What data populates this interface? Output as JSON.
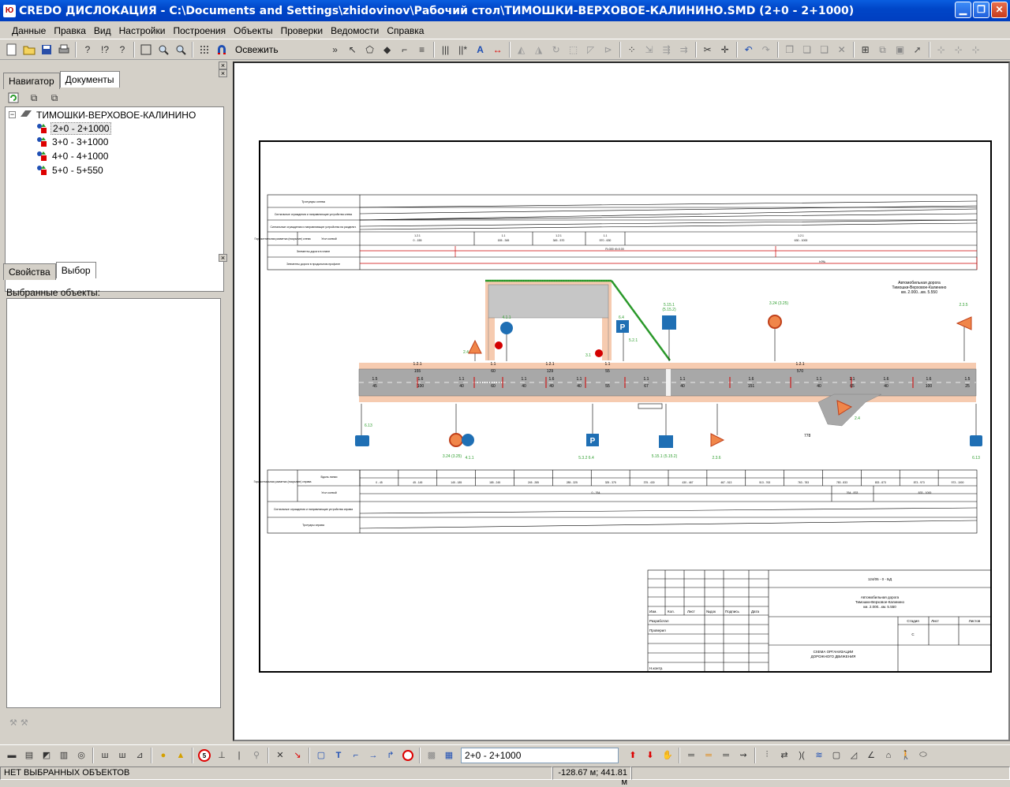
{
  "window": {
    "title": "CREDO ДИСЛОКАЦИЯ - C:\\Documents and Settings\\zhidovinov\\Рабочий стол\\ТИМОШКИ-ВЕРХОВОЕ-КАЛИНИНО.SMD (2+0 - 2+1000)",
    "app_icon_text": "Ю",
    "minimize": "▁",
    "maximize": "❐",
    "close": "✕"
  },
  "menu": [
    "Данные",
    "Правка",
    "Вид",
    "Настройки",
    "Построения",
    "Объекты",
    "Проверки",
    "Ведомости",
    "Справка"
  ],
  "toolbar": {
    "refresh_label": "Освежить",
    "more": "»"
  },
  "left_panel": {
    "tabs": [
      "Навигатор",
      "Документы"
    ],
    "active_tab": "Документы",
    "close": "×",
    "tree": {
      "root": "ТИМОШКИ-ВЕРХОВОЕ-КАЛИНИНО",
      "expander": "−",
      "items": [
        "2+0 - 2+1000",
        "3+0 - 3+1000",
        "4+0 - 4+1000",
        "5+0 - 5+550"
      ],
      "selected": "2+0 - 2+1000"
    },
    "bottom_tabs": [
      "Свойства",
      "Выбор"
    ],
    "bottom_active": "Выбор",
    "selected_objects_label": "Выбранные объекты:"
  },
  "drawing": {
    "header_rows_top": [
      "Тротуары слева",
      "Сигнальные ограждения и направляющие устройства слева",
      "Сигнальные ограждения и направляющие устройства на разделит.",
      "Горизонтальная разметка (покрытие) слева",
      "Элементы дороги в плане",
      "Элементы дороги в продольном профиле"
    ],
    "row4_sub": "Угол осевой",
    "row4_segments": [
      "1.2.1",
      "1.1",
      "1.2.1",
      "1.1",
      "1.2.1"
    ],
    "row4_ranges": [
      "0 - 155",
      "155 - 345",
      "345 - 570",
      "570 - 630",
      "630 - 1000"
    ],
    "plan_label": "R=300 r0=0.00",
    "profile_label": "i=0‰",
    "road_title": [
      "Автомобильная дорога",
      "Тимошки-Верховое-Калинино",
      "км. 2.000...км. 5.550"
    ],
    "sign_labels_top": [
      "2.4",
      "4.1.1",
      "3.24",
      "6.4",
      "5.15.1",
      "3.24 (3.25)",
      "2.3.5",
      "3.1",
      "5.2.1",
      "(5.15.2)"
    ],
    "sign_labels_bottom": [
      "6.13",
      "3.24 (3.25)",
      "4.1.1",
      "5.3.2 6.4",
      "5.15.1 (5.15.2)",
      "2.3.6",
      "2.4",
      "6.13",
      "778"
    ],
    "marking_labels_top": [
      "1.2.1",
      "1.1",
      "1.2.1",
      "1.1",
      "1.2.1"
    ],
    "marking_values_top": [
      "155",
      "60",
      "129",
      "55",
      "570"
    ],
    "lane_codes": [
      "1.5",
      "1.6",
      "1.1",
      "1.1",
      "1.1",
      "1.6",
      "1.1",
      "1.1",
      "1.6",
      "1.1",
      "1.1",
      "1.6",
      "1.5"
    ],
    "lane_values": [
      "45",
      "100",
      "40",
      "60",
      "40",
      "49",
      "40",
      "55",
      "67",
      "40",
      "151",
      "40",
      "65",
      "40",
      "100",
      "25"
    ],
    "header_rows_bottom": [
      "Горизонтальная разметка (покрытие) справа",
      "Сигнальные ограждения и направляющие устройства справа",
      "Тротуары справа"
    ],
    "bottom_sub": [
      "Вдоль линии",
      "Угол осевой"
    ],
    "bottom_ranges": [
      "0 - 45",
      "45 - 145",
      "145 - 185",
      "185 - 245",
      "245 - 285",
      "285 - 325",
      "325 - 375",
      "375 - 430",
      "430 - 467",
      "467 - 513",
      "513 - 763",
      "763 - 783",
      "783 - 833",
      "833 - 873",
      "873 - 973",
      "973 - 1000"
    ],
    "bottom_row2": [
      "0 - 764",
      "764 - 833",
      "833 - 1000"
    ],
    "stamp": {
      "code": "124/05 - 0 - БД",
      "road": [
        "Автомобильная дорога",
        "Тимошки-Верховое-Калинино",
        "км. 2.000...км. 5.550"
      ],
      "cols": [
        "Изм.",
        "Кол.",
        "Лист",
        "№док",
        "Подпись",
        "Дата"
      ],
      "roles": [
        "Разработал",
        "Проверил",
        "",
        "",
        "Н.контр."
      ],
      "stage_headers": [
        "Стадия",
        "Лист",
        "Листов"
      ],
      "stage_value": "С",
      "sheet_title": [
        "СХЕМА ОРГАНИЗАЦИИ",
        "ДОРОЖНОГО ДВИЖЕНИЯ"
      ]
    }
  },
  "bottom_toolbar": {
    "combo_value": "2+0 - 2+1000"
  },
  "status": {
    "left": "НЕТ ВЫБРАННЫХ ОБЪЕКТОВ",
    "coords": "-128.67 м; 441.81 м"
  },
  "colors": {
    "title_bar": "#0046c8",
    "road": "#a8a8a8",
    "shoulder": "#f4c8a8",
    "green": "#2e9e2e",
    "red": "#d40000",
    "sign_blue": "#1f6fb4"
  }
}
